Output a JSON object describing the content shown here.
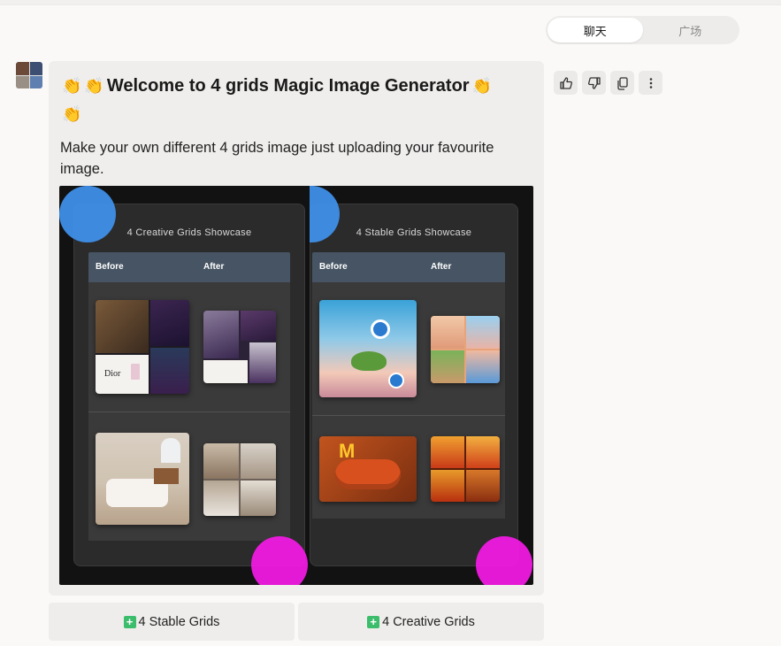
{
  "tabs": [
    {
      "label": "聊天",
      "active": true
    },
    {
      "label": "广场",
      "active": false
    }
  ],
  "message": {
    "clap_emoji": "👏",
    "title": "Welcome to 4 grids Magic Image Generator",
    "body": "Make your own different 4 grids image just uploading your favourite image."
  },
  "preview": {
    "left_panel": {
      "title": "4 Creative Grids Showcase",
      "before": "Before",
      "after": "After",
      "brand_text": "Dior"
    },
    "right_panel": {
      "title": "4 Stable Grids Showcase",
      "before": "Before",
      "after": "After"
    }
  },
  "quick_replies": [
    {
      "icon": "+",
      "label": "4 Stable Grids"
    },
    {
      "icon": "+",
      "label": "4 Creative Grids"
    }
  ],
  "colors": {
    "accent_blue": "#3f8fe8",
    "accent_magenta": "#f01ae0",
    "plus_green": "#3bbd6c"
  }
}
